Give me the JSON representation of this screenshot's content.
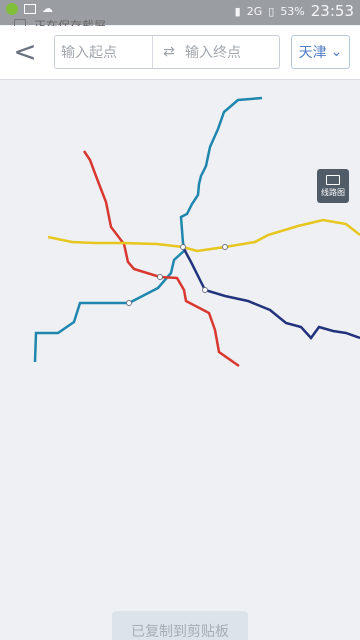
{
  "status_bar": {
    "left_notice": "正在保存截屏",
    "signal": "2G",
    "battery": "53%",
    "time": "23:53"
  },
  "toolbar": {
    "back_label": "<",
    "start_placeholder": "输入起点",
    "swap_icon": "swap-icon",
    "end_placeholder": "输入终点",
    "city_label": "天津"
  },
  "map": {
    "line_map_button_label": "线路图",
    "toast": "已复制到剪贴板"
  }
}
